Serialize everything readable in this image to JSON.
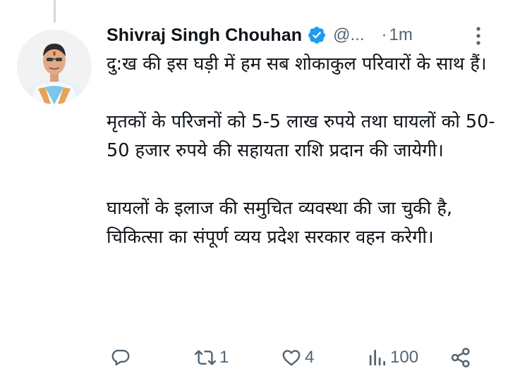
{
  "tweet": {
    "author_name": "Shivraj Singh Chouhan",
    "handle": "@...",
    "separator": "·",
    "time": "1m",
    "paragraphs": [
      "दु:ख की इस घड़ी में हम सब शोकाकुल परिवारों के साथ हैं।",
      "मृतकों के परिजनों को 5-5 लाख रुपये तथा घायलों को 50-50 हजार रुपये की सहायता राशि प्रदान की जायेगी।",
      "घायलों के इलाज की समुचित व्यवस्था की जा चुकी है, चिकित्सा का संपूर्ण व्यय प्रदेश सरकार वहन करेगी।"
    ]
  },
  "actions": {
    "reply_count": "",
    "retweet_count": "1",
    "like_count": "4",
    "views_count": "100"
  },
  "icons": {
    "verified": "verified-badge-icon",
    "more": "more-vertical-icon",
    "reply": "reply-icon",
    "retweet": "retweet-icon",
    "like": "heart-icon",
    "views": "views-chart-icon",
    "share": "share-icon"
  },
  "colors": {
    "text": "#0f1419",
    "secondary": "#536471",
    "verified_blue": "#1d9bf0",
    "thread_line": "#cfd9de"
  }
}
